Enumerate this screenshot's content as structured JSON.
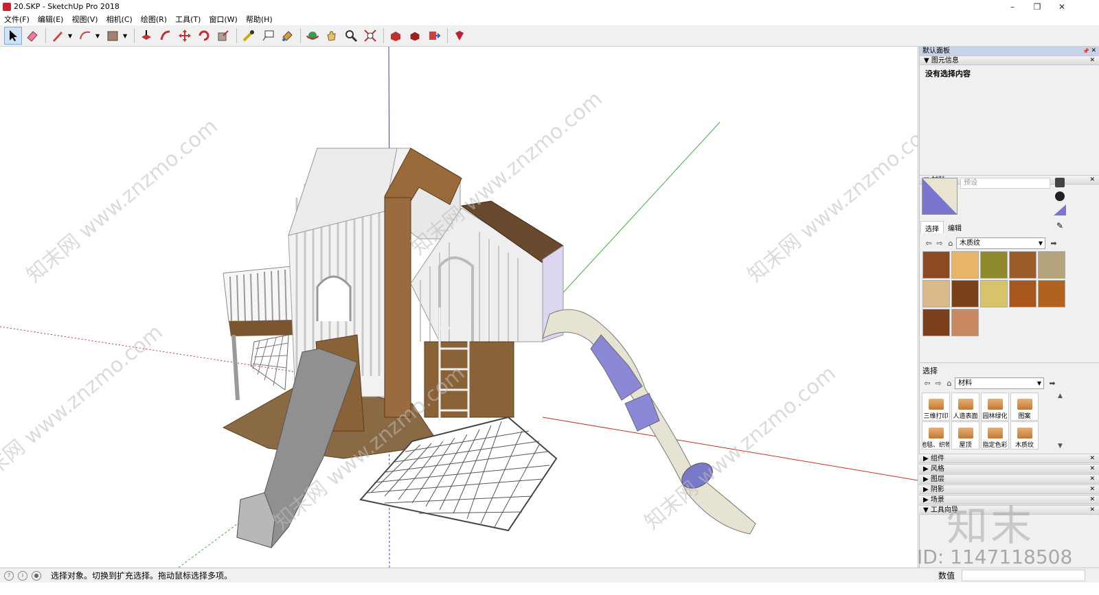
{
  "window": {
    "title": "20.SKP - SketchUp Pro 2018",
    "minimize": "–",
    "maximize": "❐",
    "close": "✕"
  },
  "menu": [
    "文件(F)",
    "编辑(E)",
    "视图(V)",
    "相机(C)",
    "绘图(R)",
    "工具(T)",
    "窗口(W)",
    "帮助(H)"
  ],
  "toolbar": [
    "select-icon",
    "eraser-icon",
    "pencil-icon",
    "arc-icon",
    "rectangle-icon",
    "pushpull-icon",
    "followme-icon",
    "move-icon",
    "rotate-icon",
    "scale-icon",
    "tape-icon",
    "text-icon",
    "paint-icon",
    "orbit-icon",
    "pan-icon",
    "zoom-icon",
    "zoom-extents-icon",
    "warehouse-icon",
    "extension-icon",
    "send-icon",
    "ruby-icon"
  ],
  "tray": {
    "title": "默认面板",
    "entity_info": {
      "header": "图元信息",
      "body": "没有选择内容"
    },
    "materials": {
      "header": "材料",
      "name_placeholder": "预设",
      "tabs": [
        "选择",
        "编辑"
      ],
      "collection": "木质纹",
      "swatch_colors": [
        "#8e4a22",
        "#e8b466",
        "#8f8a2e",
        "#9a5a2a",
        "#b5a37c",
        "#d9b98a",
        "#7a4219",
        "#d7c46a",
        "#a8551e",
        "#b0621e",
        "#7c3f1b",
        "#c98a62"
      ]
    },
    "select_section": {
      "label": "选择",
      "collection": "材料",
      "folders": [
        "三维打印",
        "人造表面",
        "园林绿化",
        "图案",
        "地毯、织物",
        "屋顶",
        "指定色彩",
        "木质纹"
      ]
    },
    "collapsed_panels": [
      "组件",
      "风格",
      "图层",
      "阴影",
      "场景",
      "工具向导"
    ]
  },
  "status": {
    "text": "选择对象。切换到扩充选择。拖动鼠标选择多项。",
    "value_label": "数值"
  },
  "watermark": {
    "site": "知末网 www.znzmo.com",
    "logo": "知末",
    "id": "ID: 1147118508"
  }
}
